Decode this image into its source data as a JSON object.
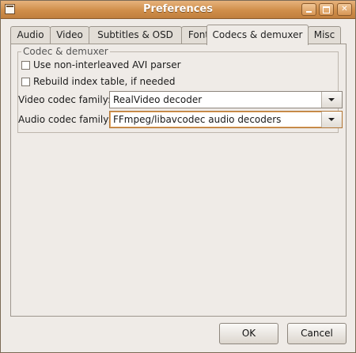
{
  "window": {
    "title": "Preferences"
  },
  "tabs": [
    {
      "label": "Audio"
    },
    {
      "label": "Video"
    },
    {
      "label": "Subtitles & OSD"
    },
    {
      "label": "Font"
    },
    {
      "label": "Codecs & demuxer"
    },
    {
      "label": "Misc"
    }
  ],
  "active_tab": "Codecs & demuxer",
  "panel": {
    "frame_title": "Codec & demuxer",
    "checkboxes": [
      {
        "label": "Use non-interleaved AVI parser",
        "checked": false
      },
      {
        "label": "Rebuild index table, if needed",
        "checked": false
      }
    ],
    "video_codec": {
      "label": "Video codec family:",
      "value": "RealVideo decoder"
    },
    "audio_codec": {
      "label": "Audio codec family:",
      "value": "FFmpeg/libavcodec audio decoders"
    }
  },
  "buttons": {
    "ok": "OK",
    "cancel": "Cancel"
  },
  "icons": {
    "window_icon": "app-window-icon",
    "minimize": "minimize-icon",
    "maximize": "maximize-icon",
    "close": "close-icon",
    "dropdown": "chevron-down-icon"
  },
  "colors": {
    "titlebar": "#d08e4a",
    "focus": "#e0a565",
    "window_bg": "#efebe7"
  }
}
